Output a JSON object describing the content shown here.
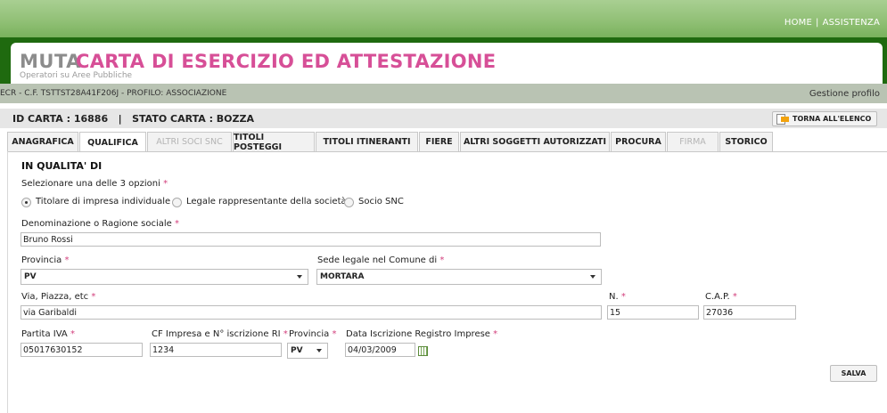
{
  "top_nav": {
    "home": "HOME",
    "separator": "|",
    "assistance": "ASSISTENZA"
  },
  "header": {
    "brand": "MUTA",
    "title": "CARTA DI ESERCIZIO ED ATTESTAZIONE",
    "subtitle": "Operatori su Aree Pubbliche"
  },
  "info_bar": {
    "user_info": "ECR - C.F. TSTTST28A41F206J - PROFILO: ASSOCIAZIONE",
    "profile_link": "Gestione profilo"
  },
  "card_bar": {
    "status_text": "ID CARTA : 16886   |   STATO CARTA : BOZZA",
    "back_button": "TORNA ALL'ELENCO"
  },
  "tabs": [
    {
      "label": "ANAGRAFICA",
      "state": "normal"
    },
    {
      "label": "QUALIFICA",
      "state": "active"
    },
    {
      "label": "ALTRI SOCI SNC",
      "state": "disabled"
    },
    {
      "label": "TITOLI POSTEGGI",
      "state": "normal"
    },
    {
      "label": "TITOLI ITINERANTI",
      "state": "normal"
    },
    {
      "label": "FIERE",
      "state": "normal"
    },
    {
      "label": "ALTRI SOGGETTI AUTORIZZATI",
      "state": "normal"
    },
    {
      "label": "PROCURA",
      "state": "normal"
    },
    {
      "label": "FIRMA",
      "state": "disabled"
    },
    {
      "label": "STORICO",
      "state": "normal"
    }
  ],
  "form": {
    "section_title": "IN QUALITA' DI",
    "required_mark": "*",
    "options_label": "Selezionare una delle 3 opzioni",
    "options": [
      {
        "label": "Titolare di impresa individuale",
        "selected": true
      },
      {
        "label": "Legale rappresentante della società",
        "selected": false
      },
      {
        "label": "Socio SNC",
        "selected": false
      }
    ],
    "denominazione": {
      "label": "Denominazione o Ragione sociale",
      "value": "Bruno Rossi"
    },
    "provincia": {
      "label": "Provincia",
      "value": "PV"
    },
    "sede_legale": {
      "label": "Sede legale nel Comune di",
      "value": "MORTARA"
    },
    "via": {
      "label": "Via, Piazza, etc",
      "value": "via Garibaldi"
    },
    "numero": {
      "label": "N.",
      "value": "15"
    },
    "cap": {
      "label": "C.A.P.",
      "value": "27036"
    },
    "partita_iva": {
      "label": "Partita IVA",
      "value": "05017630152"
    },
    "cf_impresa": {
      "label": "CF Impresa e N° iscrizione RI",
      "value": "1234"
    },
    "provincia_ri": {
      "label": "Provincia",
      "value": "PV"
    },
    "data_iscrizione": {
      "label": "Data Iscrizione Registro Imprese",
      "value": "04/03/2009"
    },
    "save_button": "SALVA"
  }
}
